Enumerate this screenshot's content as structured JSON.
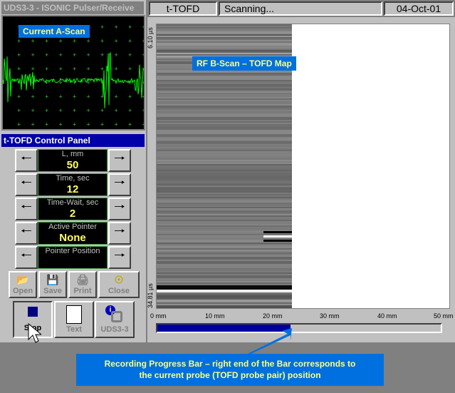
{
  "ascan": {
    "window_title": "UDS3-3 - ISONIC Pulser/Receive",
    "label": "Current A-Scan"
  },
  "control_panel": {
    "title": "t-TOFD Control Panel",
    "params": [
      {
        "label": "L, mm",
        "value": "50"
      },
      {
        "label": "Time, sec",
        "value": "12"
      },
      {
        "label": "Time-Wait, sec",
        "value": "2"
      },
      {
        "label": "Active Pointer",
        "value": "None"
      },
      {
        "label": "Pointer Position",
        "value": ""
      }
    ],
    "file_buttons": [
      "Open",
      "Save",
      "Print",
      "Close"
    ],
    "big_buttons": [
      "Stop",
      "Text",
      "UDS3-3"
    ]
  },
  "topbar": {
    "mode": "t-TOFD",
    "status": "Scanning...",
    "date": "04-Oct-01"
  },
  "bscan": {
    "label": "RF B-Scan – TOFD Map",
    "y_top": "6.10 µs",
    "y_bottom": "34.81 µs",
    "x_ticks": [
      "0 mm",
      "10 mm",
      "20 mm",
      "30 mm",
      "40 mm",
      "50 mm"
    ],
    "progress_fraction": 0.47
  },
  "callout": {
    "line1": "Recording Progress Bar – right end of the Bar corresponds to",
    "line2": "the current probe (TOFD probe pair) position"
  }
}
